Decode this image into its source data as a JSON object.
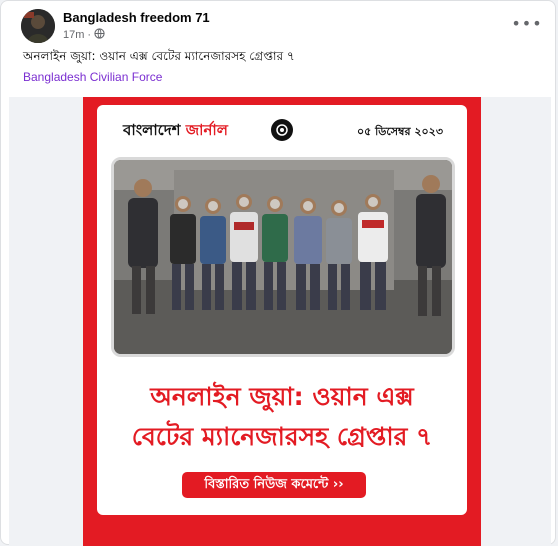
{
  "post": {
    "page_name": "Bangladesh freedom 71",
    "time": "17m",
    "separator": "·",
    "privacy_icon": "globe-icon",
    "text": "অনলাইন জুয়া: ওয়ান এক্স বেটের ম্যানেজারসহ গ্রেপ্তার ৭",
    "link": "Bangladesh Civilian Force",
    "more_icon": "more-options-icon",
    "more_label": "•••"
  },
  "poster": {
    "brand_part1": "বাংলাদেশ",
    "brand_part2": "জার্নাল",
    "date": "০৫ ডিসেম্বর ২০২৩",
    "headline_line1": "অনলাইন জুয়া: ওয়ান এক্স",
    "headline_line2": "বেটের ম্যানেজারসহ গ্রেপ্তার ৭",
    "cta": "বিস্তারিত নিউজ কমেন্টে ››",
    "accent_color": "#e31b23",
    "photo_description_icon": "group-photo"
  }
}
